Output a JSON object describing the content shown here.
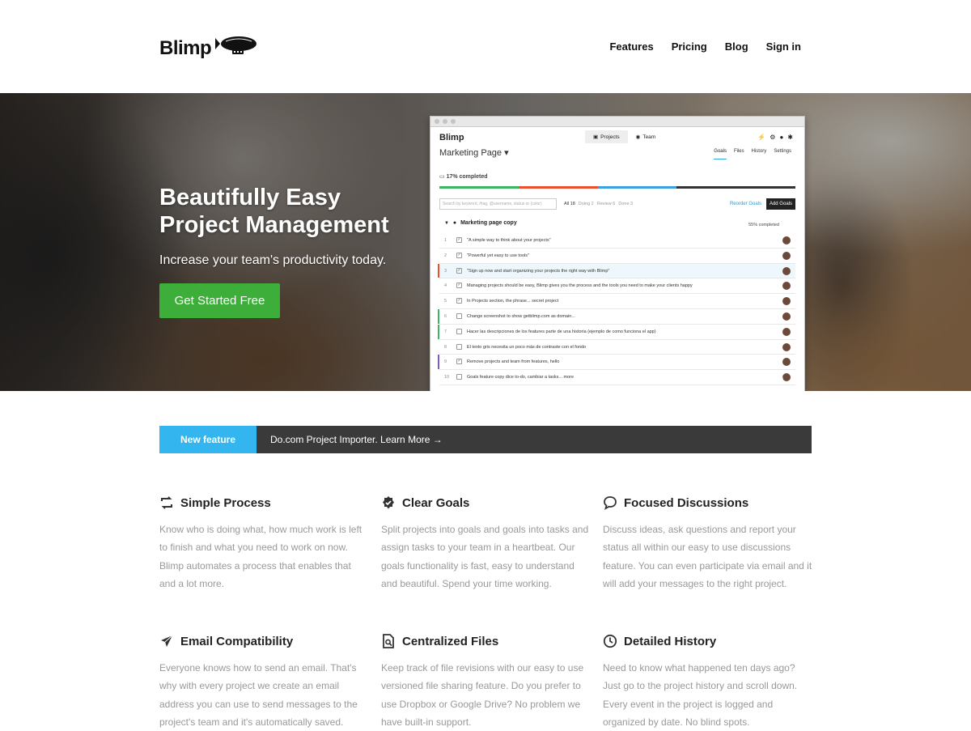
{
  "brand": {
    "name": "Blimp"
  },
  "nav": {
    "items": [
      "Features",
      "Pricing",
      "Blog",
      "Sign in"
    ]
  },
  "hero": {
    "title_line1": "Beautifully Easy",
    "title_line2": "Project Management",
    "subtitle": "Increase your team's productivity today.",
    "cta": "Get Started Free"
  },
  "app": {
    "logo": "Blimp",
    "tabs": [
      "Projects",
      "Team"
    ],
    "project_title": "Marketing Page",
    "project_tabs": [
      "Goals",
      "Files",
      "History",
      "Settings"
    ],
    "progress_label": "17% completed",
    "progress_colors": [
      "#3db365",
      "#e8502f",
      "#3aa0e0",
      "#333333"
    ],
    "search_placeholder": "Search by keyword, #tag, @username, status or (color)",
    "filters": {
      "all": "All 18",
      "doing": "Doing 2",
      "review": "Review 6",
      "done": "Done 3"
    },
    "reorder": "Reorder Goals",
    "add_goals": "Add Goals",
    "goal": {
      "title": "Marketing page copy",
      "pct": "55% completed"
    },
    "tasks": [
      {
        "n": "1",
        "text": "\"A simple way to think about your projects\"",
        "checked": true,
        "strip": ""
      },
      {
        "n": "2",
        "text": "\"Powerful yet easy to use tools\"",
        "checked": true,
        "strip": ""
      },
      {
        "n": "3",
        "text": "\"Sign up now and start organizing your projects the right way with Blimp\"",
        "checked": true,
        "strip": "#e8502f"
      },
      {
        "n": "4",
        "text": "Managing projects should be easy, Blimp gives you the process and the tools you need to make your clients happy",
        "checked": true,
        "strip": ""
      },
      {
        "n": "5",
        "text": "In Projects section, the phrase... secret project",
        "checked": true,
        "strip": ""
      },
      {
        "n": "6",
        "text": "Change screenshot to show getblimp.com as domain...",
        "checked": false,
        "strip": "#3db365"
      },
      {
        "n": "7",
        "text": "Hacer las descripciones de los features parte de una historia (ejemplo de como funciona el app)",
        "checked": false,
        "strip": "#3db365"
      },
      {
        "n": "8",
        "text": "El texto gris necesita un poco más de contraste con el fondo",
        "checked": false,
        "strip": ""
      },
      {
        "n": "9",
        "text": "Remove projects and team from features, hello",
        "checked": true,
        "strip": "#7b5cc9"
      },
      {
        "n": "10",
        "text": "Goals feature copy dice to-do, cambiar a tasks... more",
        "checked": false,
        "strip": ""
      }
    ]
  },
  "announcement": {
    "tag": "New feature",
    "text": "Do.com Project Importer. Learn More →"
  },
  "features": [
    {
      "icon": "refresh-icon",
      "title": "Simple Process",
      "body": "Know who is doing what, how much work is left to finish and what you need to work on now. Blimp automates a process that enables that and a lot more."
    },
    {
      "icon": "badge-check-icon",
      "title": "Clear Goals",
      "body": "Split projects into goals and goals into tasks and assign tasks to your team in a heartbeat. Our goals functionality is fast, easy to understand and beautiful. Spend your time working."
    },
    {
      "icon": "chat-bubble-icon",
      "title": "Focused Discussions",
      "body": "Discuss ideas, ask questions and report your status all within our easy to use discussions feature. You can even participate via email and it will add your messages to the right project."
    },
    {
      "icon": "paper-plane-icon",
      "title": "Email Compatibility",
      "body": "Everyone knows how to send an email. That's why with every project we create an email address you can use to send messages to the project's team and it's automatically saved."
    },
    {
      "icon": "file-search-icon",
      "title": "Centralized Files",
      "body": "Keep track of file revisions with our easy to use versioned file sharing feature. Do you prefer to use Dropbox or Google Drive? No problem we have built-in support."
    },
    {
      "icon": "clock-icon",
      "title": "Detailed History",
      "body": "Need to know what happened ten days ago? Just go to the project history and scroll down. Every event in the project is logged and organized by date. No blind spots."
    }
  ]
}
